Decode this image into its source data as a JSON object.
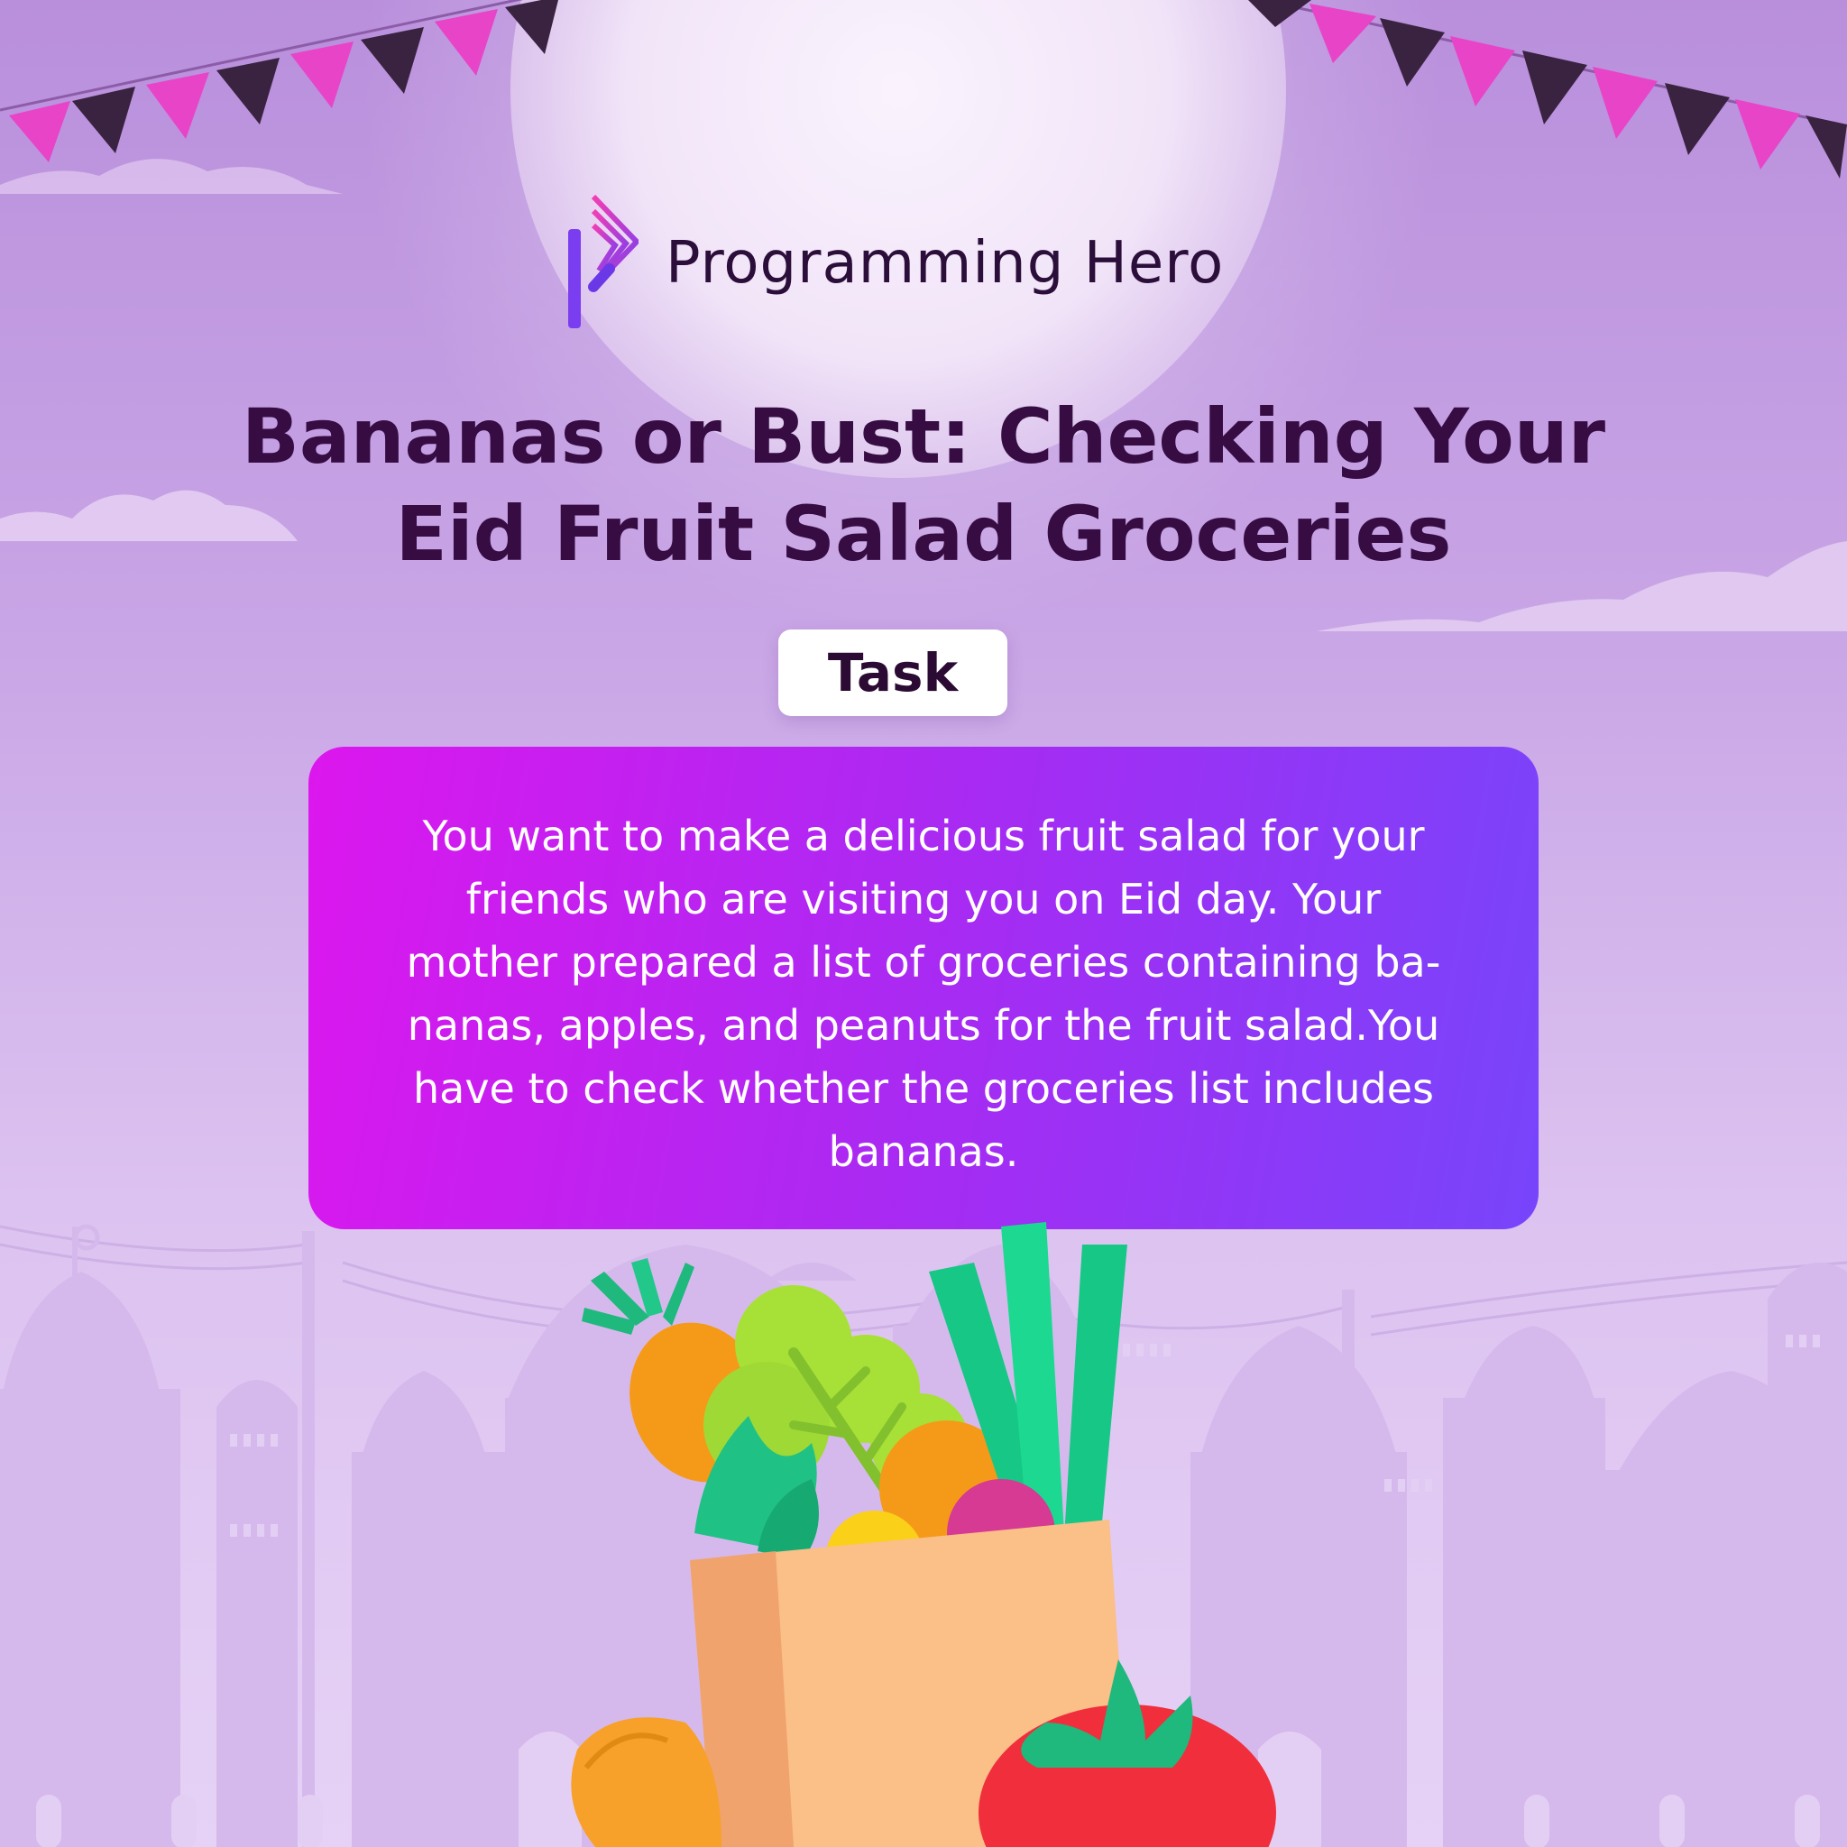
{
  "brand": {
    "name": "Programming Hero"
  },
  "headline": {
    "line1": "Bananas or Bust: Checking Your",
    "line2": "Eid Fruit Salad Groceries"
  },
  "task": {
    "badge_label": "Task",
    "description": "You want to make a delicious fruit salad for your friends who are visiting you on Eid day. Your mother prepared a list of groceries containing ba- nanas, apples, and peanuts for the fruit salad.You have to check whether the groceries list includes bananas."
  },
  "colors": {
    "background_top": "#b98fdc",
    "background_bottom": "#e6d2f6",
    "headline": "#360c42",
    "card_gradient_start": "#dc17ee",
    "card_gradient_end": "#7745fb",
    "bunting_pink": "#e844c8",
    "bunting_dark": "#3a2340"
  }
}
